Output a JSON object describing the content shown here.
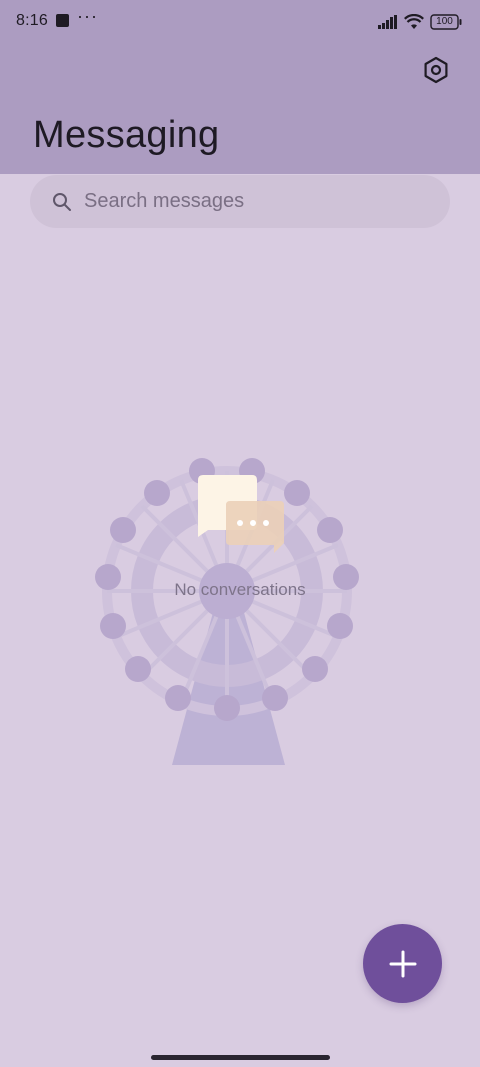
{
  "status_bar": {
    "time": "8:16",
    "more": "···",
    "battery": "100",
    "icons": [
      "app-notification-icon",
      "signal-icon",
      "wifi-icon",
      "battery-icon"
    ]
  },
  "header": {
    "title": "Messaging",
    "settings_icon": "gear-icon"
  },
  "search": {
    "placeholder": "Search messages",
    "icon": "search-icon"
  },
  "empty_state": {
    "message": "No conversations",
    "illustration": "ferris-wheel-illustration"
  },
  "fab": {
    "icon": "plus-icon"
  },
  "colors": {
    "header_bg": "#ac9cc1",
    "page_bg": "#d9cce1",
    "search_bg": "#cfc2d7",
    "fab_bg": "#6f4f9b"
  }
}
